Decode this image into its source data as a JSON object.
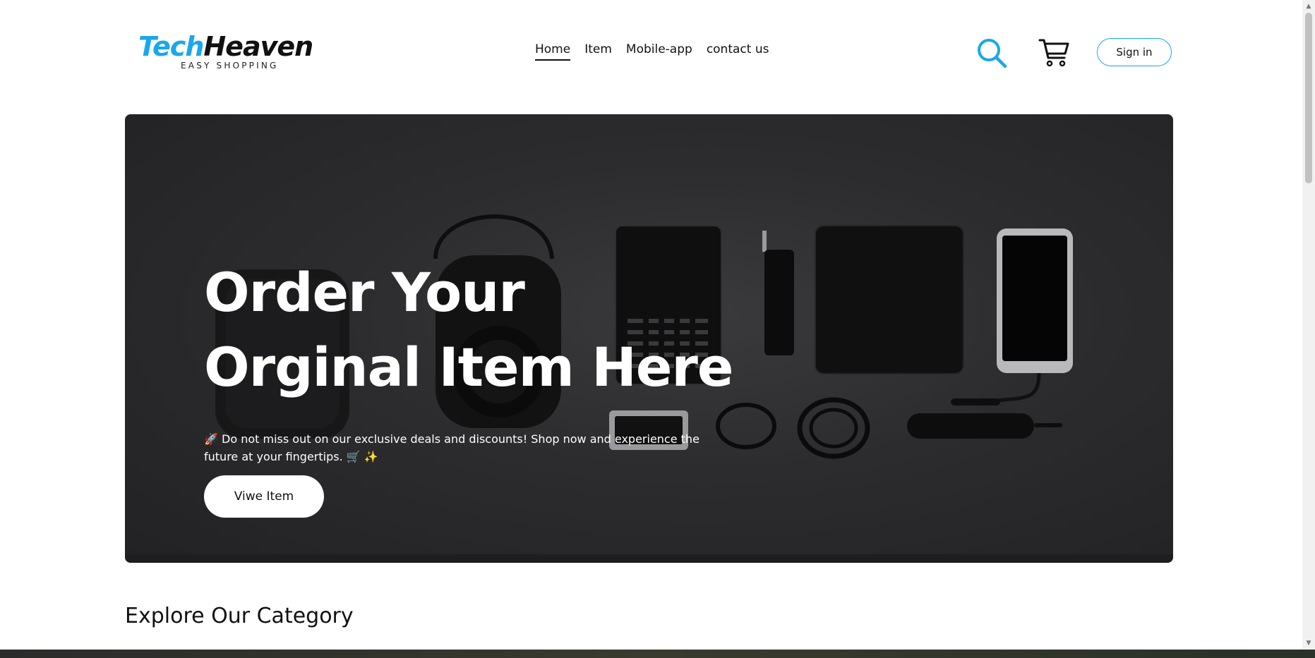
{
  "brand": {
    "name_part1": "Tech",
    "name_part2": "Heaven",
    "tagline": "EASY SHOPPING",
    "accent_color": "#1aa7ec"
  },
  "nav": {
    "items": [
      {
        "label": "Home",
        "active": true
      },
      {
        "label": "Item",
        "active": false
      },
      {
        "label": "Mobile-app",
        "active": false
      },
      {
        "label": "contact us",
        "active": false
      }
    ]
  },
  "header": {
    "search_icon": "search-icon",
    "cart_icon": "cart-icon",
    "signin_label": "Sign in"
  },
  "hero": {
    "title": "Order Your Orginal Item Here",
    "subtitle": "🚀 Do not miss out on our exclusive deals and discounts! Shop now and experience the future at your fingertips. 🛒 ✨",
    "button_label": "Viwe Item"
  },
  "section": {
    "title": "Explore Our Category"
  }
}
